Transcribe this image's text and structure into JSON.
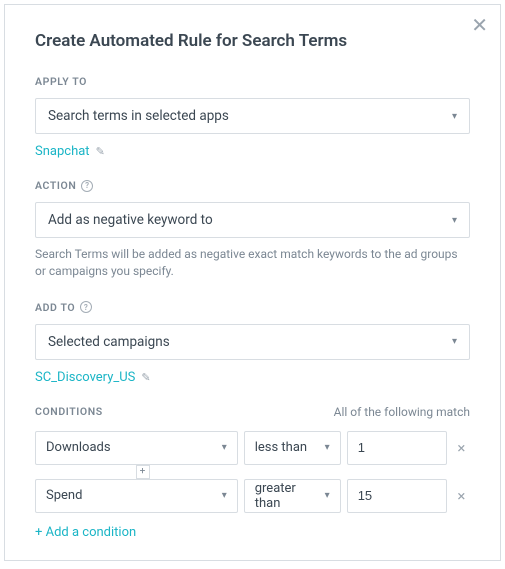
{
  "title": "Create Automated Rule for Search Terms",
  "applyTo": {
    "label": "APPLY TO",
    "value": "Search terms in selected apps",
    "tag": "Snapchat"
  },
  "action": {
    "label": "ACTION",
    "value": "Add as negative keyword to",
    "helper": "Search Terms will be added as negative exact match keywords to the ad groups or campaigns you specify."
  },
  "addTo": {
    "label": "ADD TO",
    "value": "Selected campaigns",
    "tag": "SC_Discovery_US"
  },
  "conditions": {
    "label": "CONDITIONS",
    "sub": "All of the following match",
    "rows": [
      {
        "metric": "Downloads",
        "op": "less than",
        "val": "1"
      },
      {
        "metric": "Spend",
        "op": "greater than",
        "val": "15"
      }
    ],
    "add": "+ Add a condition"
  }
}
